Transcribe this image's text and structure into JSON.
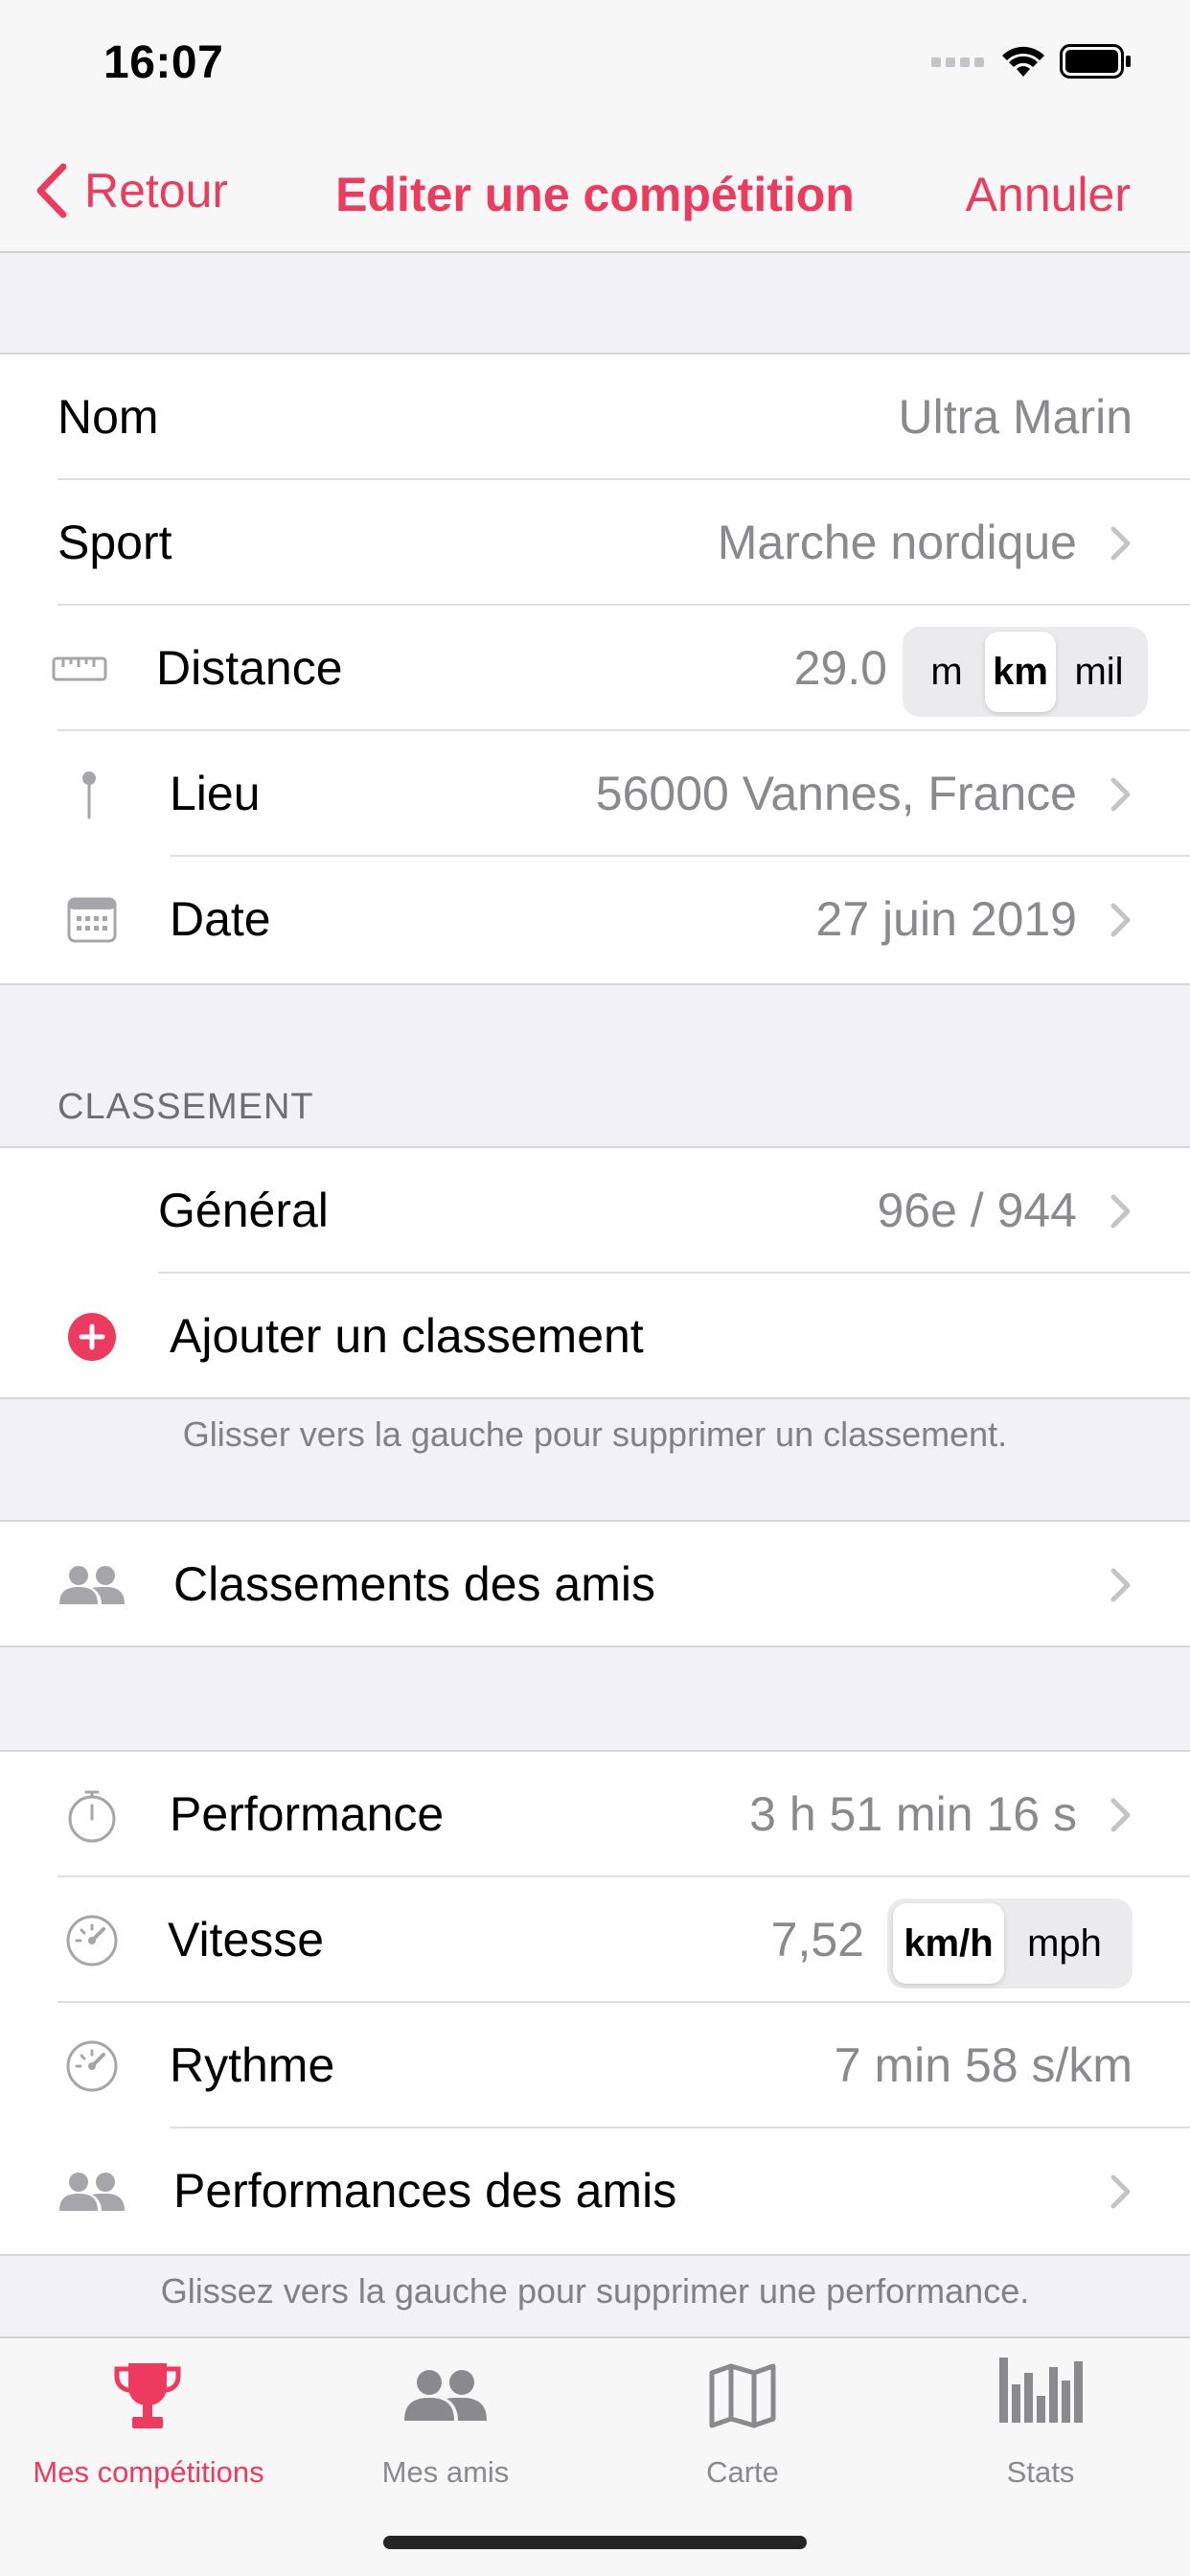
{
  "status_bar": {
    "time": "16:07"
  },
  "nav": {
    "back_label": "Retour",
    "title": "Editer une compétition",
    "cancel_label": "Annuler"
  },
  "main_section": {
    "name": {
      "label": "Nom",
      "value": "Ultra Marin"
    },
    "sport": {
      "label": "Sport",
      "value": "Marche nordique"
    },
    "distance": {
      "label": "Distance",
      "value": "29.0",
      "units": [
        "m",
        "km",
        "mil"
      ],
      "selected_unit": "km"
    },
    "place": {
      "label": "Lieu",
      "value": "56000 Vannes, France"
    },
    "date": {
      "label": "Date",
      "value": "27 juin 2019"
    }
  },
  "ranking_section": {
    "header": "CLASSEMENT",
    "general": {
      "label": "Général",
      "value": "96e / 944"
    },
    "add_label": "Ajouter un classement",
    "footer": "Glisser vers la gauche pour supprimer un classement."
  },
  "friends_ranking": {
    "label": "Classements des amis"
  },
  "performance_section": {
    "performance": {
      "label": "Performance",
      "value": "3 h 51 min 16 s"
    },
    "speed": {
      "label": "Vitesse",
      "value": "7,52",
      "units": [
        "km/h",
        "mph"
      ],
      "selected_unit": "km/h"
    },
    "pace": {
      "label": "Rythme",
      "value": "7 min 58 s/km"
    },
    "friends_perf": {
      "label": "Performances des amis"
    },
    "footer": "Glissez vers la gauche pour supprimer une performance."
  },
  "tab_bar": {
    "tabs": [
      {
        "label": "Mes compétitions",
        "icon": "trophy-icon",
        "active": true
      },
      {
        "label": "Mes amis",
        "icon": "people-icon",
        "active": false
      },
      {
        "label": "Carte",
        "icon": "map-icon",
        "active": false
      },
      {
        "label": "Stats",
        "icon": "bar-chart-icon",
        "active": false
      }
    ]
  },
  "colors": {
    "accent": "#ed3a5f",
    "secondary_text": "#8a8a8e",
    "background": "#f2f2f6",
    "icon_gray": "#a6a6aa"
  }
}
